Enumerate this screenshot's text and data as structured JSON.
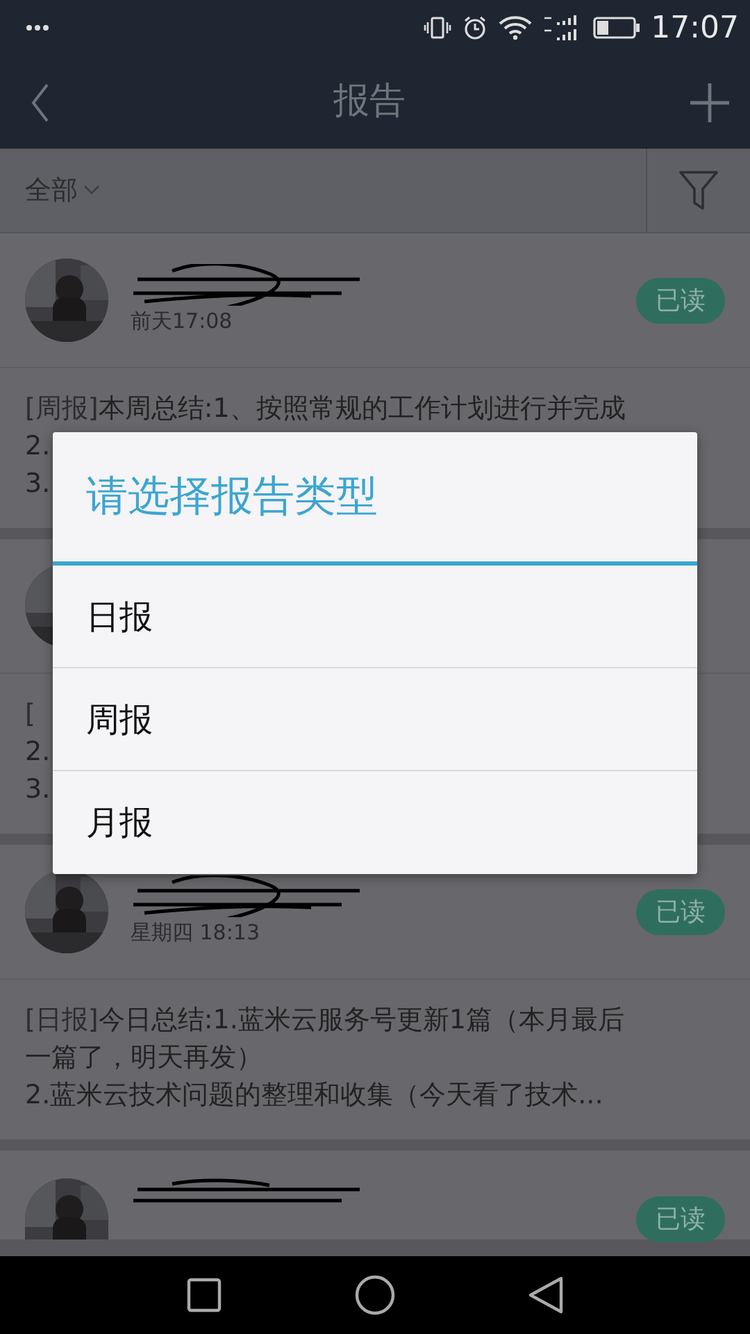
{
  "status_bar": {
    "time": "17:07"
  },
  "app_bar": {
    "title": "报告"
  },
  "filter_bar": {
    "scope": "全部"
  },
  "reports": [
    {
      "time": "前天17:08",
      "read_badge": "已读",
      "lines": [
        {
          "tag": "[周报]",
          "text": "本周总结:1、按照常规的工作计划进行并完成"
        },
        {
          "text": "2."
        },
        {
          "text": "3."
        }
      ]
    },
    {
      "lines": [
        {
          "tag": "["
        },
        {
          "text": "2."
        },
        {
          "text": "3."
        }
      ]
    },
    {
      "time": "星期四 18:13",
      "read_badge": "已读",
      "lines": [
        {
          "tag": "[日报]",
          "text": "今日总结:1.蓝米云服务号更新1篇（本月最后"
        },
        {
          "text": "一篇了，明天再发）"
        },
        {
          "text": "2.蓝米云技术问题的整理和收集（今天看了技术..."
        }
      ]
    },
    {
      "read_badge": "已读"
    }
  ],
  "dialog": {
    "title": "请选择报告类型",
    "options": [
      "日报",
      "周报",
      "月报"
    ]
  }
}
